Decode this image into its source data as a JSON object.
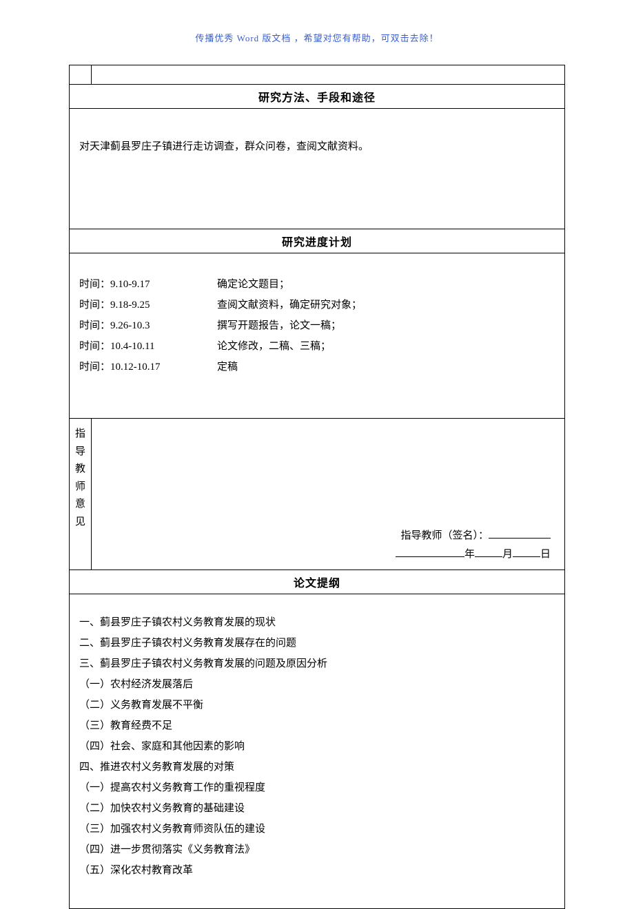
{
  "header_notice": "传播优秀 Word 版文档 ，希望对您有帮助，可双击去除！",
  "sections": {
    "methods": {
      "title": "研究方法、手段和途径",
      "content": "对天津蓟县罗庄子镇进行走访调查，群众问卷，查阅文献资料。"
    },
    "progress": {
      "title": "研究进度计划",
      "schedule": [
        {
          "time": "时间：9.10-9.17",
          "task": "确定论文题目；"
        },
        {
          "time": "时间：9.18-9.25",
          "task": "查阅文献资料，确定研究对象；"
        },
        {
          "time": "时间：9.26-10.3",
          "task": "撰写开题报告，论文一稿；"
        },
        {
          "time": "时间：10.4-10.11",
          "task": "论文修改，二稿、三稿；"
        },
        {
          "time": "时间：10.12-10.17",
          "task": "定稿"
        }
      ]
    },
    "advisor": {
      "label": "指导教师意见",
      "signature_label": "指导教师（签名）：",
      "year_label": "年",
      "month_label": "月",
      "day_label": "日"
    },
    "outline": {
      "title": "论文提纲",
      "items": [
        "一、蓟县罗庄子镇农村义务教育发展的现状",
        "二、蓟县罗庄子镇农村义务教育发展存在的问题",
        "三、蓟县罗庄子镇农村义务教育发展的问题及原因分析",
        "（一）农村经济发展落后",
        "（二）义务教育发展不平衡",
        "（三）教育经费不足",
        "（四）社会、家庭和其他因素的影响",
        "四、推进农村义务教育发展的对策",
        "（一）提高农村义务教育工作的重视程度",
        "（二）加快农村义务教育的基础建设",
        "（三）加强农村义务教育师资队伍的建设",
        "（四）进一步贯彻落实《义务教育法》",
        "（五）深化农村教育改革"
      ]
    }
  }
}
